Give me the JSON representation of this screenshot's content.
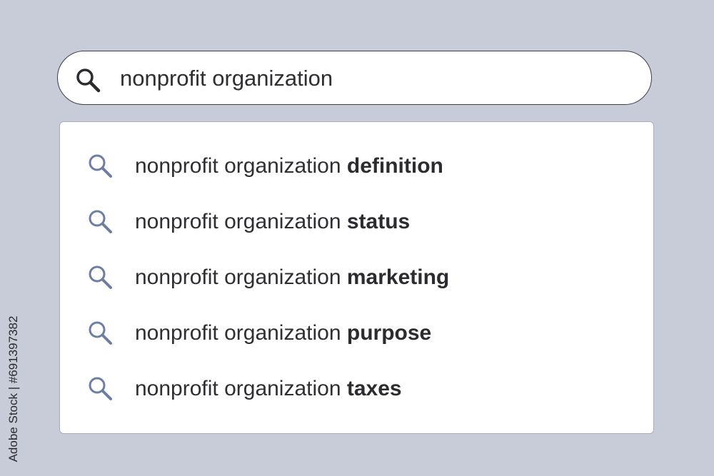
{
  "search": {
    "query": "nonprofit organization",
    "icon": "search-icon"
  },
  "suggestions": [
    {
      "prefix": "nonprofit organization ",
      "completion": "definition"
    },
    {
      "prefix": "nonprofit organization ",
      "completion": "status"
    },
    {
      "prefix": "nonprofit organization ",
      "completion": "marketing"
    },
    {
      "prefix": "nonprofit organization ",
      "completion": "purpose"
    },
    {
      "prefix": "nonprofit organization ",
      "completion": "taxes"
    }
  ],
  "watermark": {
    "text": "Adobe Stock | #691397382"
  },
  "colors": {
    "background": "#c8ccd8",
    "search_icon_dark": "#2b2b30",
    "suggestion_icon": "#6d7ea3",
    "text": "#2e2e33"
  }
}
